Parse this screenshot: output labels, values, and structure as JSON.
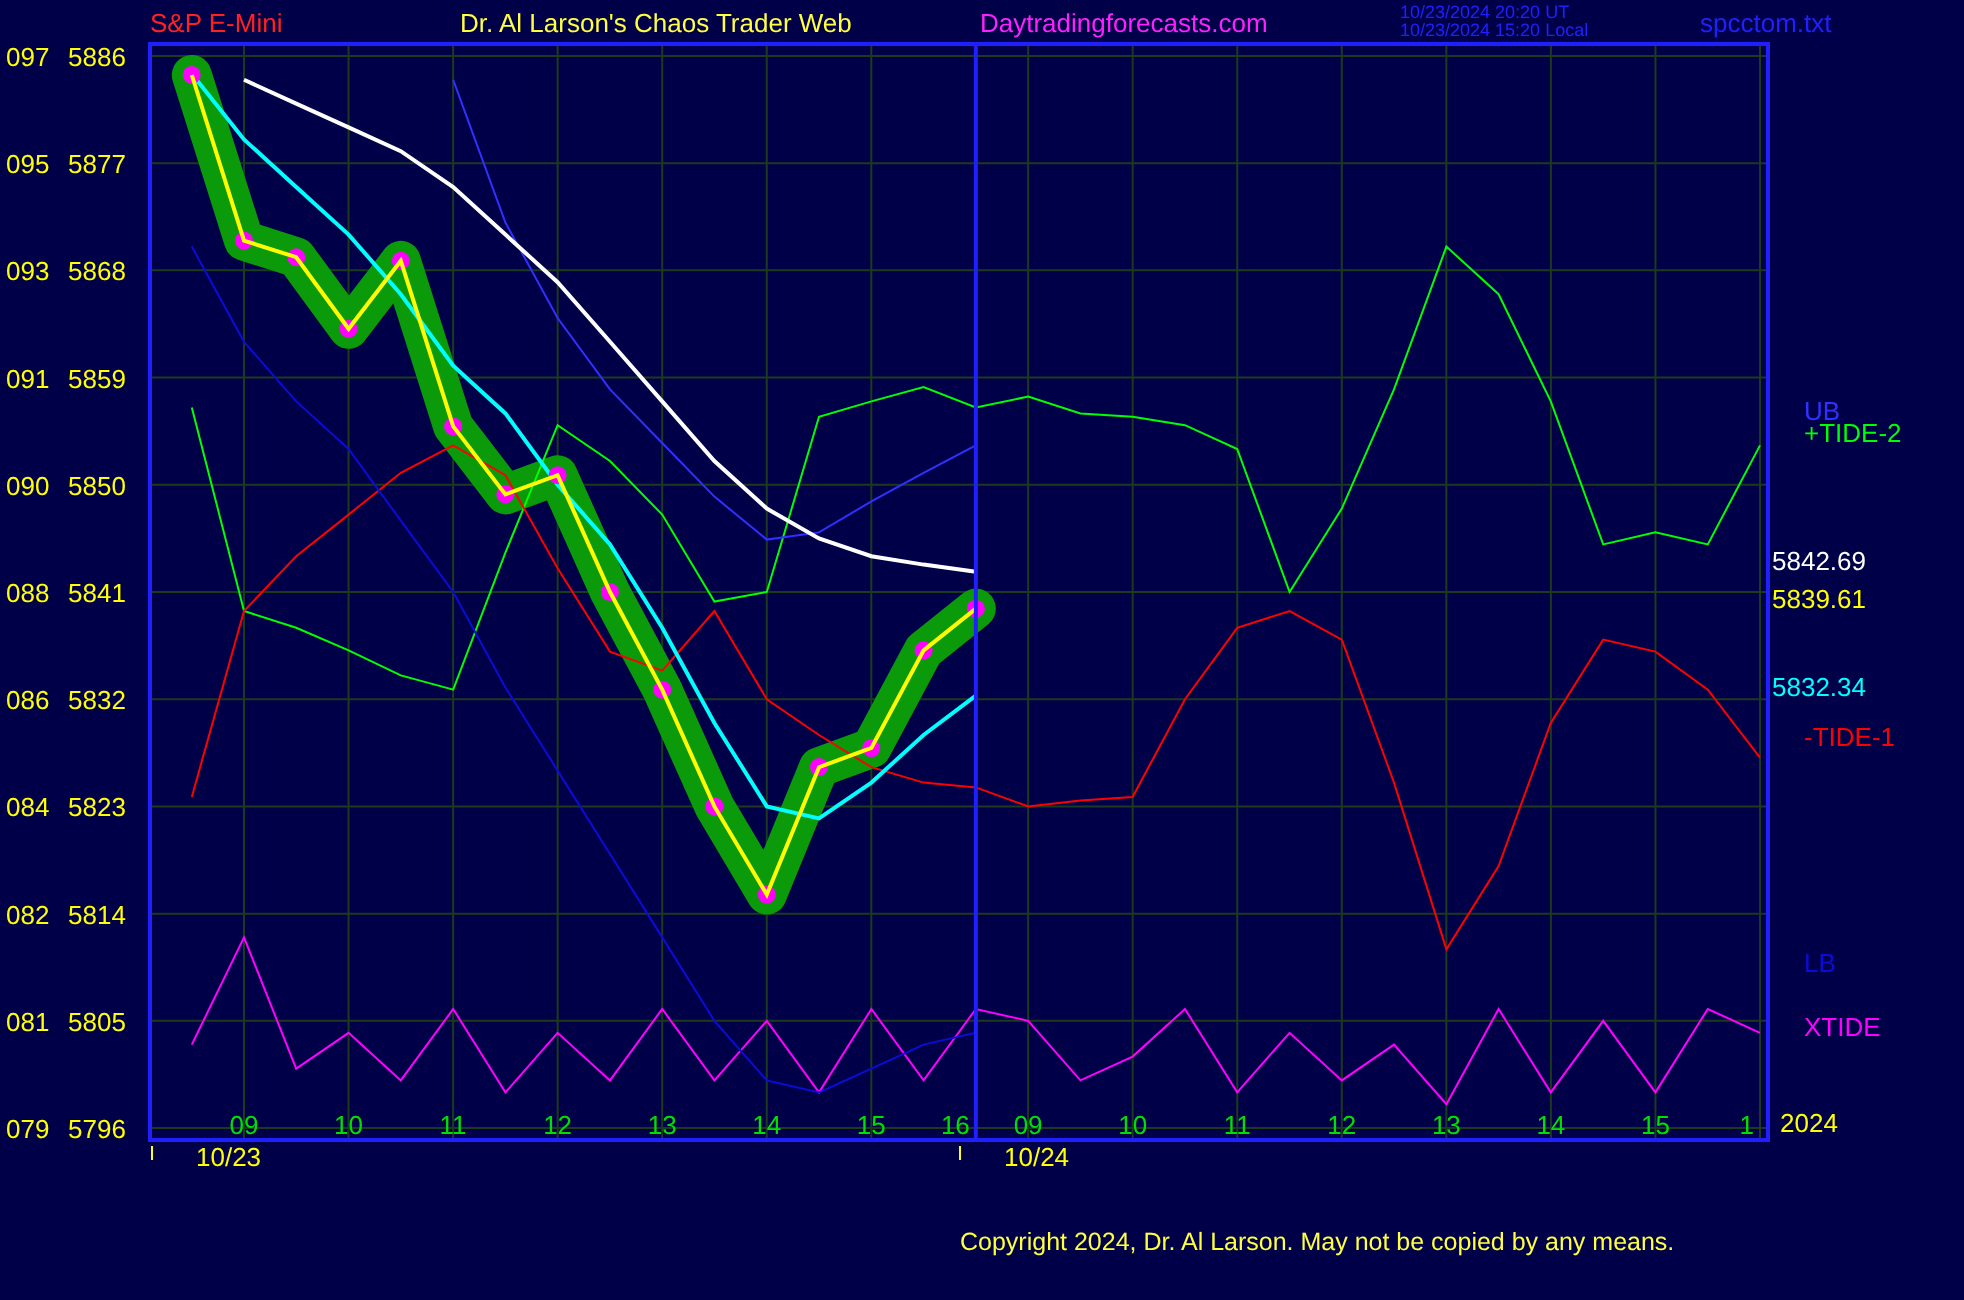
{
  "header": {
    "symbol": "S&P E-Mini",
    "title": "Dr. Al Larson's Chaos Trader Web",
    "website": "Daytradingforecasts.com",
    "timestamps": [
      "10/23/2024 20:20  UT",
      "10/23/2024 15:20  Local"
    ],
    "file": "spcctom.txt"
  },
  "chart": {
    "chart_data": {
      "type": "line",
      "categories": [
        null,
        "09",
        null,
        "10",
        null,
        "11",
        null,
        "12",
        null,
        "13",
        null,
        "14",
        null,
        "15",
        null,
        "16",
        "09",
        null,
        "10",
        null,
        "11",
        null,
        "12",
        null,
        "13",
        null,
        "14",
        null,
        "15",
        null,
        "1"
      ],
      "series": [
        {
          "name": "XTIDE",
          "color": "#ff00ff",
          "values": [
            5803,
            5812,
            5801,
            5804,
            5800,
            5806,
            5799,
            5804,
            5800,
            5806,
            5800,
            5805,
            5799,
            5806,
            5800,
            5806,
            5805,
            5800,
            5802,
            5806,
            5799,
            5804,
            5800,
            5803,
            5798,
            5806,
            5799,
            5805,
            5799,
            5806,
            5804
          ]
        },
        {
          "name": "+TIDE-2",
          "color": "#00ff00",
          "values": [
            5856.5,
            5839.4,
            5838,
            5836.1,
            5834,
            5832.8,
            5844.3,
            5855,
            5852,
            5847.5,
            5840.2,
            5841,
            5855.7,
            5857,
            5858.2,
            5856.5,
            5857.4,
            5856,
            5855.7,
            5855,
            5853,
            5841,
            5848,
            5858,
            5870,
            5866,
            5857,
            5845,
            5846,
            5845,
            5853.3
          ]
        },
        {
          "name": "-TIDE-1",
          "color": "#ff0000",
          "values": [
            5823.8,
            5839.4,
            5844,
            5847.5,
            5851,
            5853.3,
            5850.8,
            5843,
            5836,
            5834.4,
            5839.4,
            5832,
            5829,
            5826.3,
            5825,
            5824.6,
            5823,
            5823.5,
            5823.8,
            5832,
            5838,
            5839.4,
            5837,
            5825,
            5811,
            5818,
            5830,
            5837,
            5836,
            5832.8,
            5827.1
          ]
        },
        {
          "name": "UB",
          "color": "#3030ff",
          "values": [
            null,
            null,
            null,
            null,
            null,
            5884,
            5872,
            5864,
            5858,
            5853.5,
            5849,
            5845.4,
            5846,
            5848.6,
            5851,
            5853.3,
            null,
            null,
            null,
            null,
            null,
            null,
            null,
            null,
            null,
            null,
            null,
            null,
            null,
            null,
            null
          ]
        },
        {
          "name": "LB",
          "color": "#0c0cd8",
          "values": [
            5870,
            5862,
            5857,
            5853,
            5847,
            5841,
            5833,
            5826,
            5819,
            5812,
            5805,
            5800,
            5799,
            5801,
            5803,
            5804,
            null,
            null,
            null,
            null,
            null,
            null,
            null,
            null,
            null,
            null,
            null,
            null,
            null,
            null,
            null
          ]
        },
        {
          "color": "#ffffff",
          "values": [
            null,
            5884,
            5882,
            5880,
            5878,
            5875,
            5871,
            5867,
            5862,
            5857,
            5852,
            5848,
            5845.5,
            5844,
            5843.3,
            5842.7,
            null,
            null,
            null,
            null,
            null,
            null,
            null,
            null,
            null,
            null,
            null,
            null,
            null,
            null,
            null
          ]
        },
        {
          "color": "#00ffff",
          "values": [
            5884.5,
            5879,
            5875,
            5871,
            5866,
            5860,
            5856,
            5850,
            5845,
            5838,
            5830,
            5823,
            5822,
            5825,
            5829,
            5832.3,
            null,
            null,
            null,
            null,
            null,
            null,
            null,
            null,
            null,
            null,
            null,
            null,
            null,
            null,
            null
          ]
        },
        {
          "color": "#ffff00",
          "marker": true,
          "values": [
            5884.4,
            5870.5,
            5869.1,
            5863.1,
            5868.8,
            5854.9,
            5849.2,
            5850.8,
            5841,
            5832.8,
            5823,
            5815.6,
            5826.3,
            5827.9,
            5836.1,
            5839.6,
            null,
            null,
            null,
            null,
            null,
            null,
            null,
            null,
            null,
            null,
            null,
            null,
            null,
            null,
            null
          ]
        }
      ],
      "grid": true,
      "ref_lines": [
        {
          "axis": "x",
          "value": "16",
          "color": "#2020ff"
        }
      ],
      "ylim": [
        5795,
        5887
      ],
      "yticks": [
        5886,
        5877,
        5868,
        5859,
        5850,
        5841,
        5832,
        5823,
        5814,
        5805,
        5796
      ]
    },
    "left_scale": [
      "097",
      "095",
      "093",
      "091",
      "090",
      "088",
      "086",
      "084",
      "082",
      "081",
      "079"
    ],
    "side_labels": [
      {
        "text": "5842.69",
        "color": "#ffffff"
      },
      {
        "text": "5839.61",
        "color": "#ffff00"
      },
      {
        "text": "5832.34",
        "color": "#00ffff"
      },
      {
        "text": "2024",
        "color": "#ffff00"
      }
    ],
    "dates": [
      "10/23",
      "10/24"
    ]
  },
  "footer": {
    "copyright": "Copyright 2024, Dr. Al Larson. May not be copied by any means."
  }
}
